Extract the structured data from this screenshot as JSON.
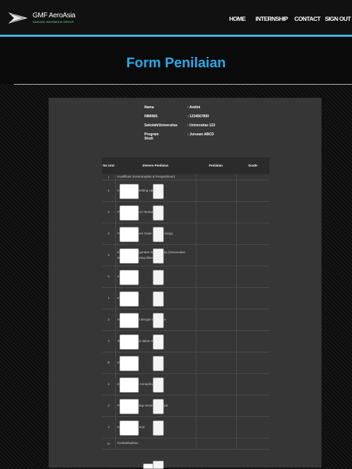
{
  "header": {
    "logo_text": "GMF AeroAsia",
    "logo_tagline": "GARUDA INDONESIA GROUP",
    "nav": [
      "HOME",
      "INTERNSHIP",
      "CONTACT",
      "SIGN OUT"
    ],
    "accent": "#3fb3e8"
  },
  "page": {
    "title": "Form Penilaian",
    "title_color": "#2aa8e8"
  },
  "student": {
    "rows": [
      {
        "label": "Nama",
        "value": ": Andini"
      },
      {
        "label": "NIM/NIS",
        "value": ": 1234567890"
      },
      {
        "label": "Sekolah/Universitas",
        "value": ": Universitas 123"
      },
      {
        "label": "Program Studi",
        "value": ": Jurusan ABCD"
      }
    ]
  },
  "table": {
    "headers": {
      "no": "No Urut",
      "element": "Elemen Penilaian",
      "score": "Penilaian",
      "grade": "Grade"
    },
    "rows": [
      {
        "no": "I",
        "element": "Kualifikasi (Keterampilan & Pengetahuan)",
        "inputs": false
      },
      {
        "no": "1",
        "element": "Keterampilan / Setting Up",
        "inputs": true
      },
      {
        "no": "2",
        "element": "Pemahaman Teori Tambahan",
        "inputs": true
      },
      {
        "no": "3",
        "element": "Pemahaman Work Order (Proses Kerja)",
        "inputs": true
      },
      {
        "no": "4",
        "element": "Efektifitas Penggunaan Waktu Kerja (Kesesuaian dengan Waktu yang diberikan)",
        "inputs": true
      },
      {
        "no": "II",
        "element": "Kedisiplinan",
        "inputs": true
      },
      {
        "no": "1",
        "element": "Kedisiplinan",
        "inputs": true
      },
      {
        "no": "2",
        "element": "Hubungan Kerja dengan Karyawan",
        "inputs": true
      },
      {
        "no": "3",
        "element": "Tanggung Jawab dalam Waktu",
        "inputs": true
      },
      {
        "no": "III",
        "element": "Kreativitas",
        "inputs": true
      },
      {
        "no": "1",
        "element": "Kebersihan dan Kerapihan Kerja",
        "inputs": true
      },
      {
        "no": "2",
        "element": "Perhatian terhadap Intruksi/Petunjuk",
        "inputs": true
      },
      {
        "no": "3",
        "element": "Kelancaran Bekerja",
        "inputs": true
      },
      {
        "no": "IV",
        "element": "Ketidakhadiran",
        "inputs": false
      }
    ]
  }
}
